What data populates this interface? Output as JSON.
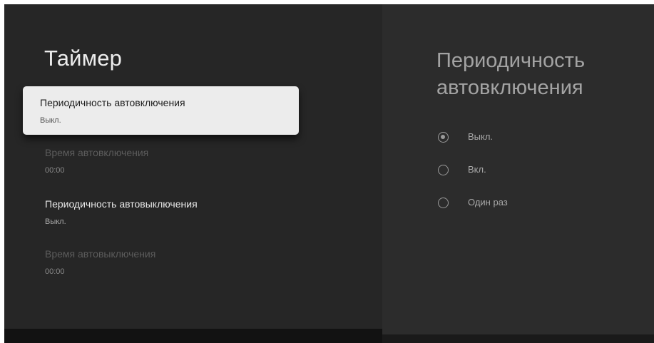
{
  "left_panel": {
    "title": "Таймер",
    "items": [
      {
        "label": "Периодичность автовключения",
        "value": "Выкл.",
        "state": "focused"
      },
      {
        "label": "Время автовключения",
        "value": "00:00",
        "state": "disabled"
      },
      {
        "label": "Периодичность автовыключения",
        "value": "Выкл.",
        "state": "normal"
      },
      {
        "label": "Время автовыключения",
        "value": "00:00",
        "state": "disabled"
      }
    ]
  },
  "right_panel": {
    "title_line1": "Периодичность",
    "title_line2": "автовключения",
    "options": [
      {
        "label": "Выкл.",
        "checked": true
      },
      {
        "label": "Вкл.",
        "checked": false
      },
      {
        "label": "Один раз",
        "checked": false
      }
    ]
  },
  "colors": {
    "background": "#2a2a2a",
    "focus_card": "#ececec",
    "text_primary": "#e8e8e8",
    "text_secondary": "#a8a8a8",
    "text_disabled": "#5c5c5c"
  }
}
